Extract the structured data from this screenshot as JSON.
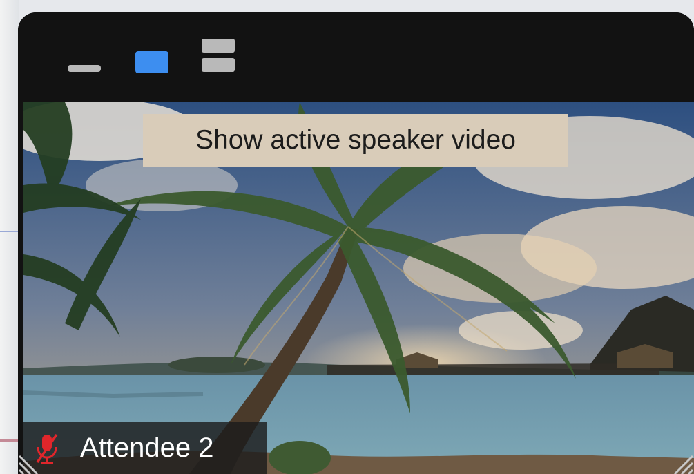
{
  "window": {
    "controls": [
      {
        "name": "minimize",
        "icon": "minimize-icon"
      },
      {
        "name": "active-speaker-view",
        "icon": "speaker-view-icon",
        "selected": true,
        "color": "#3d8ef0"
      },
      {
        "name": "gallery-view",
        "icon": "gallery-view-icon"
      }
    ]
  },
  "tooltip": {
    "text": "Show active speaker video"
  },
  "participant": {
    "name": "Attendee 2",
    "muted": true,
    "mic_icon": "mic-muted-icon",
    "mic_color": "#e0262b"
  },
  "colors": {
    "titlebar": "#121212",
    "accent": "#3d8ef0",
    "tooltip_bg": "#d9ccb9"
  }
}
